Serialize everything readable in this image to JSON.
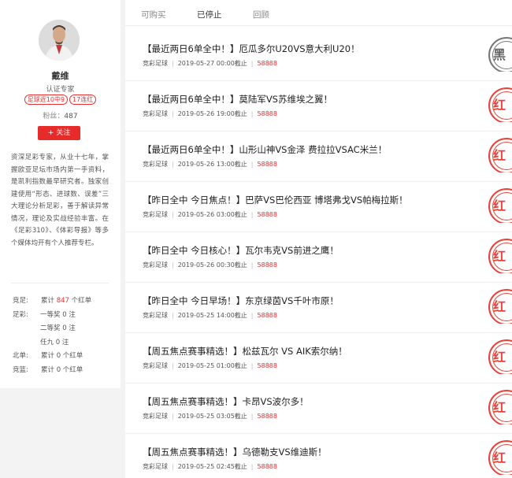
{
  "profile": {
    "name": "戴维",
    "title": "认证专家",
    "badge_recent": "足球近10中9",
    "badge_streak": "17连红",
    "fans_label": "粉丝：",
    "fans_count": "487",
    "follow_label": "+ 关注",
    "bio": "资深足彩专家，从业十七年，掌握欧亚足坛市场内第一手资料，是凯利指数最早研究者。独家创建使用“形态、进球数、误差”三大理论分析足彩，善于解读异常情况，理论及实战经验丰富。在《足彩310》、《体彩导报》等多个媒体均开有个人推荐专栏。"
  },
  "stats": {
    "jingzu_key": "竞足:",
    "jingzu_prefix": "累计",
    "jingzu_count": "847",
    "jingzu_suffix": "个红单",
    "zucai_key": "足彩:",
    "first_prize": "一等奖 0 注",
    "second_prize": "二等奖 0 注",
    "renjiu": "任九 0 注",
    "beidan_key": "北单:",
    "beidan_val": "累计 0 个红单",
    "jinglan_key": "竞篮:",
    "jinglan_val": "累计 0 个红单"
  },
  "tabs": [
    "可购买",
    "已停止",
    "回顾"
  ],
  "active_tab": "已停止",
  "items": [
    {
      "title": "【最近两日6单全中！】厄瓜多尔U20VS意大利U20！",
      "category": "竞彩足球",
      "time": "2019-05-27 00:00截止",
      "price": "58888",
      "stamp": "黑"
    },
    {
      "title": "【最近两日6单全中！】莫陆军VS苏维埃之翼！",
      "category": "竞彩足球",
      "time": "2019-05-26 19:00截止",
      "price": "58888",
      "stamp": "红"
    },
    {
      "title": "【最近两日6单全中！】山形山神VS金泽  费拉拉VSAC米兰！",
      "category": "竞彩足球",
      "time": "2019-05-26 13:00截止",
      "price": "58888",
      "stamp": "红"
    },
    {
      "title": "【昨日全中  今日焦点！】巴萨VS巴伦西亚  博塔弗戈VS帕梅拉斯！",
      "category": "竞彩足球",
      "time": "2019-05-26 03:00截止",
      "price": "58888",
      "stamp": "红"
    },
    {
      "title": "【昨日全中  今日核心！】瓦尔韦克VS前进之鹰！",
      "category": "竞彩足球",
      "time": "2019-05-26 00:30截止",
      "price": "58888",
      "stamp": "红"
    },
    {
      "title": "【昨日全中  今日早场！】东京绿茵VS千叶市原！",
      "category": "竞彩足球",
      "time": "2019-05-25 14:00截止",
      "price": "58888",
      "stamp": "红"
    },
    {
      "title": "【周五焦点赛事精选！】松兹瓦尔  VS  AIK索尔纳！",
      "category": "竞彩足球",
      "time": "2019-05-25 01:00截止",
      "price": "58888",
      "stamp": "红"
    },
    {
      "title": "【周五焦点赛事精选！】卡昂VS波尔多！",
      "category": "竞彩足球",
      "time": "2019-05-25 03:05截止",
      "price": "58888",
      "stamp": "红"
    },
    {
      "title": "【周五焦点赛事精选！】乌德勒支VS维迪斯！",
      "category": "竞彩足球",
      "time": "2019-05-25 02:45截止",
      "price": "58888",
      "stamp": "红"
    }
  ],
  "colors": {
    "accent": "#e72b2b",
    "stamp_red": "#e8433a",
    "stamp_black": "#777777"
  },
  "icons": {
    "avatar": "avatar-photo",
    "stamp_red": "hong-seal-icon",
    "stamp_black": "hei-seal-icon"
  }
}
